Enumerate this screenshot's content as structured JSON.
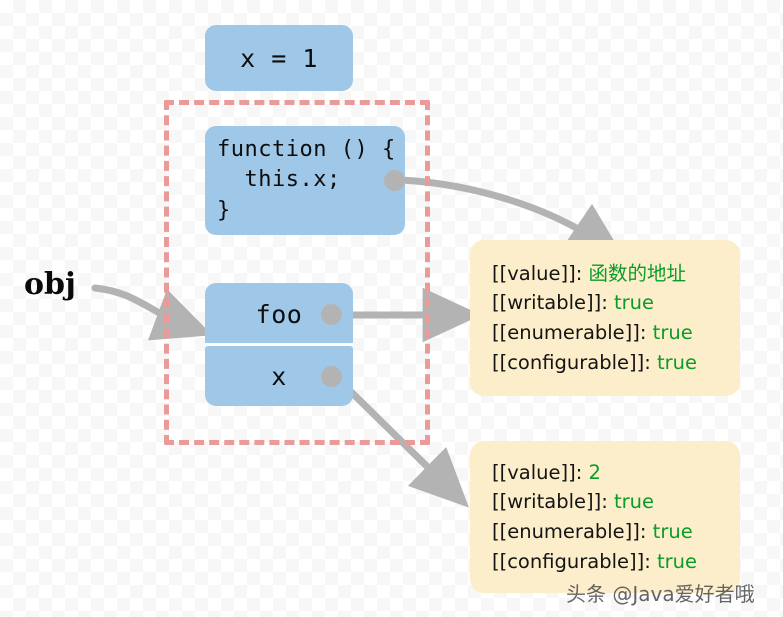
{
  "diagram": {
    "title": "JavaScript object property descriptors diagram",
    "colors": {
      "box_blue": "#9fc8e8",
      "panel_cream": "#fdeecb",
      "scope_dashed_red": "#eb9a9a",
      "value_green": "#0a9c28",
      "arrow_gray": "#b3b3b3",
      "text_black": "#141414"
    }
  },
  "labels": {
    "obj": "obj"
  },
  "boxes": {
    "assignment": "x = 1",
    "function_source": "function () {\n  this.x;\n}",
    "property_foo": "foo",
    "property_x": "x"
  },
  "panels": [
    {
      "id": "descriptor-foo",
      "rows": [
        {
          "key": "[[value]]:",
          "value": "函数的地址"
        },
        {
          "key": "[[writable]]:",
          "value": "true"
        },
        {
          "key": "[[enumerable]]:",
          "value": "true"
        },
        {
          "key": "[[configurable]]:",
          "value": "true"
        }
      ]
    },
    {
      "id": "descriptor-x",
      "rows": [
        {
          "key": "[[value]]:",
          "value": "2"
        },
        {
          "key": "[[writable]]:",
          "value": "true"
        },
        {
          "key": "[[enumerable]]:",
          "value": "true"
        },
        {
          "key": "[[configurable]]:",
          "value": "true"
        }
      ]
    }
  ],
  "watermark": {
    "text": "头条 @Java爱好者哦"
  }
}
